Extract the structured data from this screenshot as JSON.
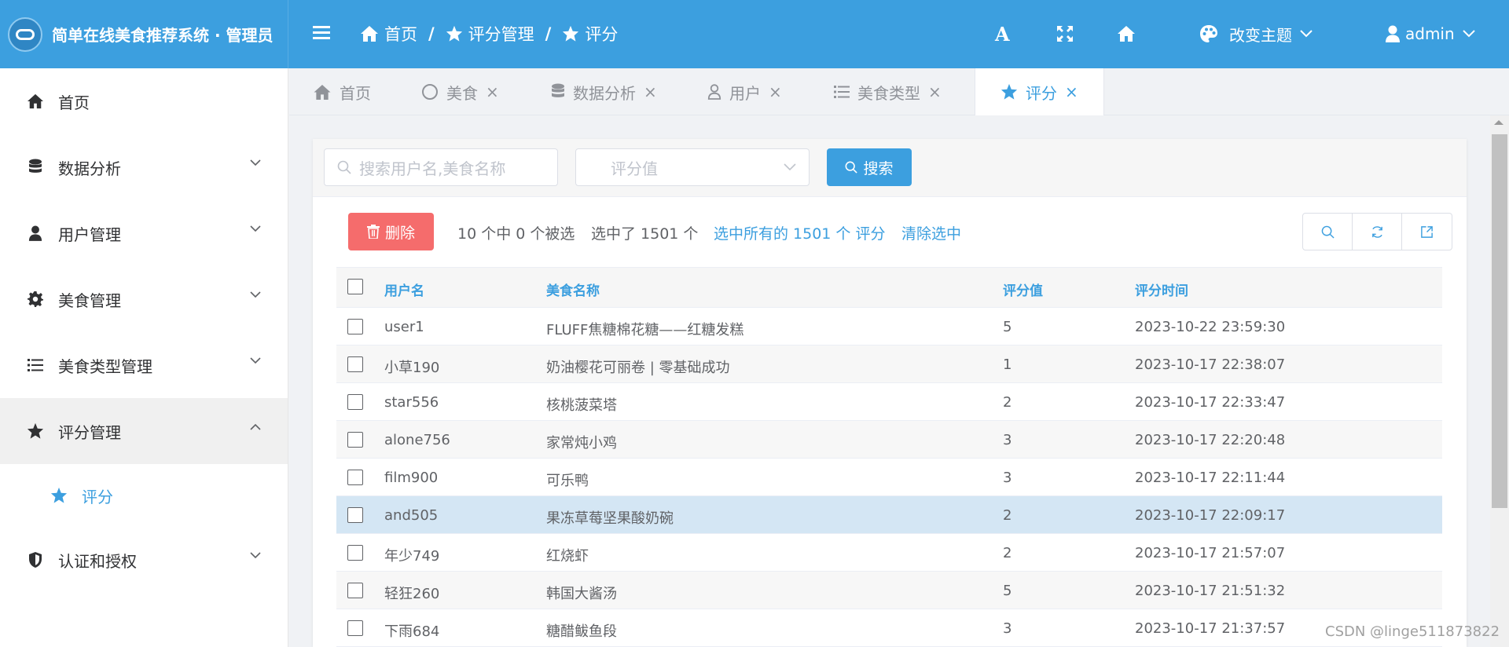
{
  "header": {
    "title": "简单在线美食推荐系统 · 管理员",
    "breadcrumb": [
      "首页",
      "评分管理",
      "评分"
    ],
    "font_icon_text": "A",
    "theme_label": "改变主题",
    "user_label": "admin",
    "accent_color": "#3c9fdf"
  },
  "sidebar": {
    "items": [
      {
        "label": "首页",
        "icon": "home-icon"
      },
      {
        "label": "数据分析",
        "icon": "database-icon"
      },
      {
        "label": "用户管理",
        "icon": "user-icon"
      },
      {
        "label": "美食管理",
        "icon": "gear-icon"
      },
      {
        "label": "美食类型管理",
        "icon": "list-icon"
      },
      {
        "label": "评分管理",
        "icon": "star-icon"
      },
      {
        "label": "认证和授权",
        "icon": "shield-icon"
      }
    ],
    "submenu": [
      {
        "label": "评分",
        "icon": "star-icon"
      }
    ]
  },
  "tabs": [
    {
      "label": "首页",
      "icon": "home-icon"
    },
    {
      "label": "美食",
      "icon": "circle-icon"
    },
    {
      "label": "数据分析",
      "icon": "database-icon"
    },
    {
      "label": "用户",
      "icon": "user-icon"
    },
    {
      "label": "美食类型",
      "icon": "list-icon"
    },
    {
      "label": "评分",
      "icon": "star-icon"
    }
  ],
  "search": {
    "keyword_placeholder": "搜索用户名,美食名称",
    "score_placeholder": "评分值",
    "search_label": "搜索"
  },
  "toolbar": {
    "delete_label": "删除",
    "selection_info": "10 个中 0 个被选",
    "selected_count": "选中了 1501 个",
    "select_all_link": "选中所有的 1501 个 评分",
    "clear_link": "清除选中"
  },
  "table": {
    "columns": [
      "用户名",
      "美食名称",
      "评分值",
      "评分时间"
    ],
    "rows": [
      {
        "user": "user1",
        "food": "FLUFF焦糖棉花糖——红糖发糕",
        "score": "5",
        "time": "2023-10-22 23:59:30"
      },
      {
        "user": "小草190",
        "food": "奶油樱花可丽卷 | 零基础成功",
        "score": "1",
        "time": "2023-10-17 22:38:07"
      },
      {
        "user": "star556",
        "food": "核桃菠菜塔",
        "score": "2",
        "time": "2023-10-17 22:33:47"
      },
      {
        "user": "alone756",
        "food": "家常炖小鸡",
        "score": "3",
        "time": "2023-10-17 22:20:48"
      },
      {
        "user": "film900",
        "food": "可乐鸭",
        "score": "3",
        "time": "2023-10-17 22:11:44"
      },
      {
        "user": "and505",
        "food": "果冻草莓坚果酸奶碗",
        "score": "2",
        "time": "2023-10-17 22:09:17"
      },
      {
        "user": "年少749",
        "food": "红烧虾",
        "score": "2",
        "time": "2023-10-17 21:57:07"
      },
      {
        "user": "轻狂260",
        "food": "韩国大酱汤",
        "score": "5",
        "time": "2023-10-17 21:51:32"
      },
      {
        "user": "下雨684",
        "food": "糖醋鲅鱼段",
        "score": "3",
        "time": "2023-10-17 21:37:57"
      }
    ]
  },
  "watermark": "CSDN @linge511873822"
}
